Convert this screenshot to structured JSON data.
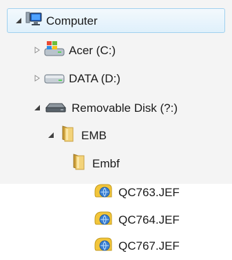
{
  "tree": {
    "computer": {
      "label": "Computer",
      "expanded": true,
      "selected": true,
      "icon": "computer-icon"
    },
    "drives": [
      {
        "label": "Acer (C:)",
        "expanded": false,
        "icon": "windows-drive-icon"
      },
      {
        "label": "DATA (D:)",
        "expanded": false,
        "icon": "hard-drive-icon"
      },
      {
        "label": "Removable Disk (?:)",
        "expanded": true,
        "icon": "removable-disk-icon"
      }
    ],
    "folders": [
      {
        "label": "EMB",
        "expanded": true,
        "icon": "folder-icon"
      },
      {
        "label": "Embf",
        "expanded": false,
        "icon": "folder-icon"
      }
    ],
    "files": [
      {
        "label": "QC763.JEF",
        "icon": "jef-file-icon"
      },
      {
        "label": "QC764.JEF",
        "icon": "jef-file-icon"
      },
      {
        "label": "QC767.JEF",
        "icon": "jef-file-icon"
      }
    ]
  },
  "colors": {
    "selection_border": "#9fd0ee",
    "selection_fill": "#dff0fb",
    "folder": "#e8c35c",
    "file_globe": "#3a7fd1"
  }
}
